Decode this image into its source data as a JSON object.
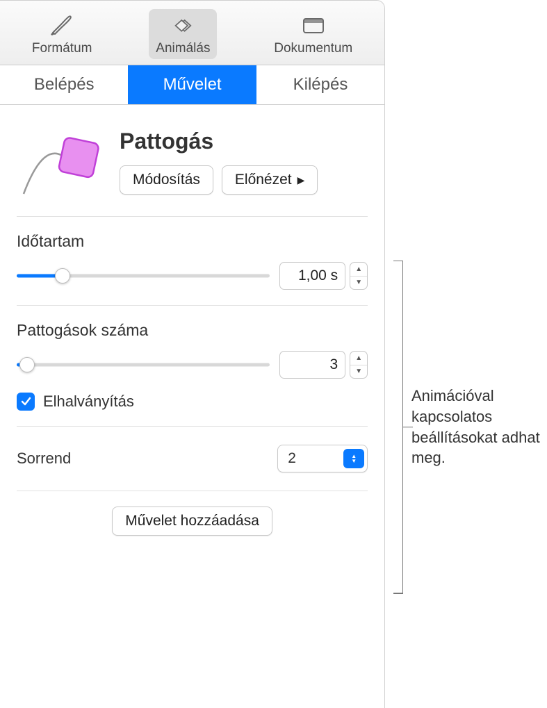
{
  "topbar": {
    "format": "Formátum",
    "animate": "Animálás",
    "document": "Dokumentum"
  },
  "subtabs": {
    "in": "Belépés",
    "action": "Művelet",
    "out": "Kilépés"
  },
  "effect": {
    "title": "Pattogás",
    "modify": "Módosítás",
    "preview": "Előnézet"
  },
  "duration": {
    "label": "Időtartam",
    "value": "1,00 s",
    "fill_percent": 18
  },
  "bounces": {
    "label": "Pattogások száma",
    "value": "3",
    "fill_percent": 4
  },
  "fade": {
    "label": "Elhalványítás",
    "checked": true
  },
  "order": {
    "label": "Sorrend",
    "value": "2"
  },
  "footer": {
    "add_action": "Művelet hozzáadása"
  },
  "callout": "Animációval kapcsolatos beállításokat adhat meg."
}
